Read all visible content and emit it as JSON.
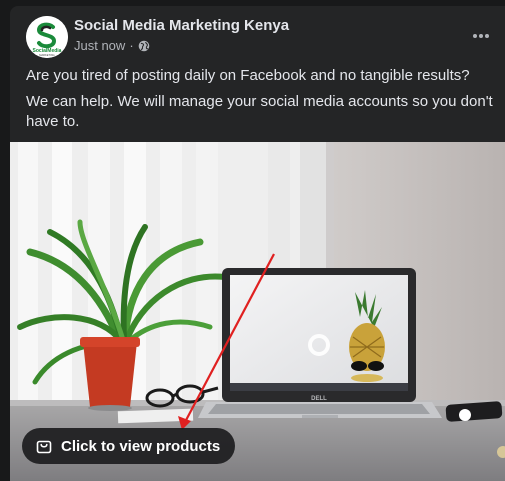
{
  "post": {
    "page_name": "Social Media Marketing Kenya",
    "timestamp": "Just now",
    "separator": "·",
    "privacy_icon": "globe-icon",
    "paragraph_1": "Are you tired of posting daily on Facebook and no tangible results?",
    "paragraph_2": "We can help. We will manage your social media accounts so you don't have to."
  },
  "avatar": {
    "logo_letter": "S",
    "logo_text": "SocialMedia",
    "logo_subtext": "MARKETING"
  },
  "media": {
    "products_button_label": "Click to view products",
    "products_button_icon": "shopping-bag-icon",
    "laptop_brand": "DELL",
    "annotation_arrow_color": "#e02020"
  },
  "colors": {
    "card_bg": "#242526",
    "text_primary": "#e4e6eb",
    "text_secondary": "#b0b3b8",
    "brand_green": "#1a8a3a"
  }
}
